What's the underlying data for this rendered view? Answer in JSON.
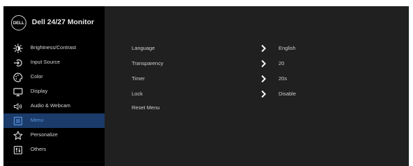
{
  "header": {
    "logo": "DELL",
    "title": "Dell 24/27 Monitor"
  },
  "sidebar": {
    "items": [
      {
        "label": "Brightness/Contrast",
        "icon": "brightness-icon"
      },
      {
        "label": "Input Source",
        "icon": "input-source-icon"
      },
      {
        "label": "Color",
        "icon": "color-icon"
      },
      {
        "label": "Display",
        "icon": "display-icon"
      },
      {
        "label": "Audio & Webcam",
        "icon": "audio-icon"
      },
      {
        "label": "Menu",
        "icon": "menu-icon",
        "active": true
      },
      {
        "label": "Personalize",
        "icon": "star-icon"
      },
      {
        "label": "Others",
        "icon": "others-icon"
      }
    ]
  },
  "main": {
    "rows": [
      {
        "label": "Language",
        "value": "English"
      },
      {
        "label": "Transparency",
        "value": "20"
      },
      {
        "label": "Timer",
        "value": "20s"
      },
      {
        "label": "Lock",
        "value": "Disable"
      },
      {
        "label": "Reset Menu"
      }
    ]
  },
  "colors": {
    "sidebar_bg": "#000000",
    "panel_bg": "#202020",
    "active_bg": "#1b3b6a",
    "active_text": "#5a93dc"
  }
}
